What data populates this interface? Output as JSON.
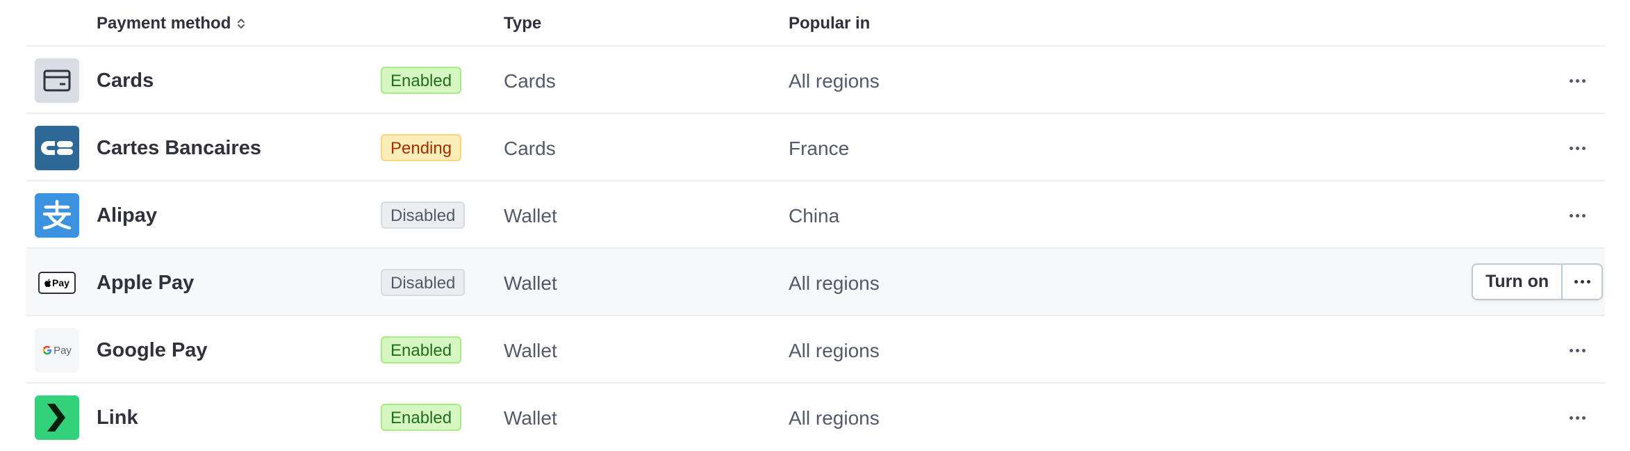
{
  "header": {
    "payment_method": "Payment method",
    "type": "Type",
    "popular_in": "Popular in"
  },
  "rows": [
    {
      "name": "Cards",
      "status": "Enabled",
      "type": "Cards",
      "popular_in": "All regions",
      "icon": "credit-card-icon"
    },
    {
      "name": "Cartes Bancaires",
      "status": "Pending",
      "type": "Cards",
      "popular_in": "France",
      "icon": "cartes-bancaires-logo"
    },
    {
      "name": "Alipay",
      "status": "Disabled",
      "type": "Wallet",
      "popular_in": "China",
      "icon": "alipay-logo"
    },
    {
      "name": "Apple Pay",
      "status": "Disabled",
      "type": "Wallet",
      "popular_in": "All regions",
      "icon": "apple-pay-logo",
      "action_label": "Turn on"
    },
    {
      "name": "Google Pay",
      "status": "Enabled",
      "type": "Wallet",
      "popular_in": "All regions",
      "icon": "google-pay-logo"
    },
    {
      "name": "Link",
      "status": "Enabled",
      "type": "Wallet",
      "popular_in": "All regions",
      "icon": "link-logo"
    }
  ],
  "logo_text": {
    "apple_pay": "Pay",
    "google_pay": "Pay"
  },
  "colors": {
    "enabled": "#216e1f",
    "pending": "#a82c00",
    "disabled": "#545969",
    "cartes_bancaires_bg": "#2d6896",
    "alipay_bg": "#3d92e0",
    "link_bg": "#33d27a"
  }
}
